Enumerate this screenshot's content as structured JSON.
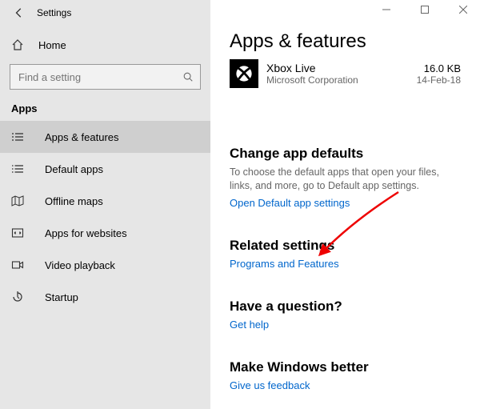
{
  "window": {
    "title": "Settings"
  },
  "sidebar": {
    "home": "Home",
    "search_placeholder": "Find a setting",
    "section": "Apps",
    "items": [
      {
        "label": "Apps & features"
      },
      {
        "label": "Default apps"
      },
      {
        "label": "Offline maps"
      },
      {
        "label": "Apps for websites"
      },
      {
        "label": "Video playback"
      },
      {
        "label": "Startup"
      }
    ]
  },
  "main": {
    "title": "Apps & features",
    "app": {
      "name": "Xbox Live",
      "publisher": "Microsoft Corporation",
      "size": "16.0 KB",
      "date": "14-Feb-18"
    },
    "defaults": {
      "heading": "Change app defaults",
      "desc": "To choose the default apps that open your files, links, and more, go to Default app settings.",
      "link": "Open Default app settings"
    },
    "related": {
      "heading": "Related settings",
      "link": "Programs and Features"
    },
    "question": {
      "heading": "Have a question?",
      "link": "Get help"
    },
    "feedback": {
      "heading": "Make Windows better",
      "link": "Give us feedback"
    }
  }
}
